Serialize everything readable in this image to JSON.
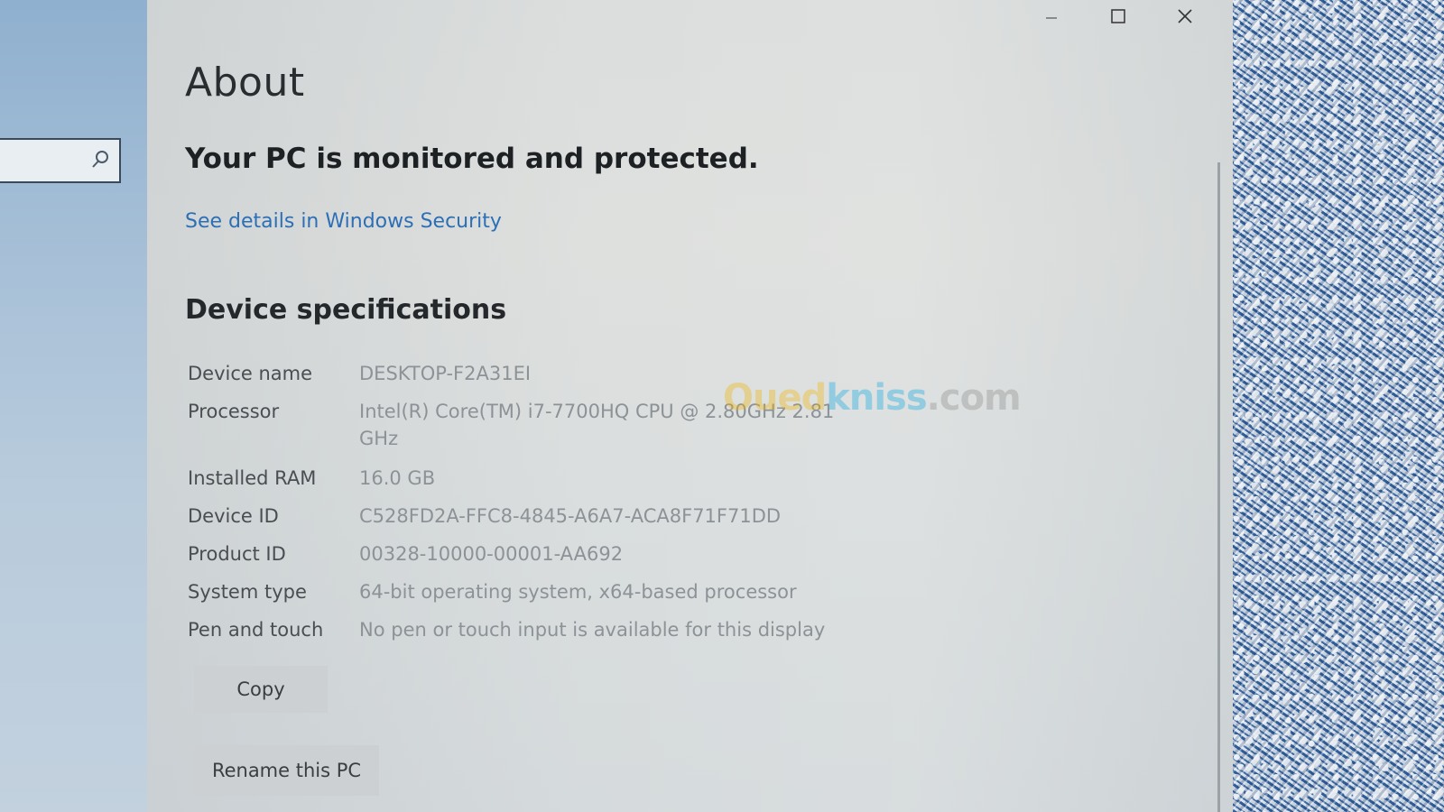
{
  "window": {
    "title": "About",
    "controls": {
      "minimize_icon": "minimize-icon",
      "maximize_icon": "maximize-icon",
      "close_icon": "close-icon"
    }
  },
  "sidebar": {
    "search_icon": "search-icon"
  },
  "status": {
    "heading": "Your PC is monitored and protected.",
    "link": "See details in Windows Security"
  },
  "device_specs": {
    "heading": "Device specifications",
    "rows": [
      {
        "label": "Device name",
        "value": "DESKTOP-F2A31EI"
      },
      {
        "label": "Processor",
        "value": "Intel(R) Core(TM) i7-7700HQ CPU @ 2.80GHz   2.81 GHz"
      },
      {
        "label": "Installed RAM",
        "value": "16.0 GB"
      },
      {
        "label": "Device ID",
        "value": "C528FD2A-FFC8-4845-A6A7-ACA8F71F71DD"
      },
      {
        "label": "Product ID",
        "value": "00328-10000-00001-AA692"
      },
      {
        "label": "System type",
        "value": "64-bit operating system, x64-based processor"
      },
      {
        "label": "Pen and touch",
        "value": "No pen or touch input is available for this display"
      }
    ],
    "copy_button": "Copy"
  },
  "rename_button": "Rename this PC",
  "watermark": {
    "part1": "Oued",
    "part2": "kniss",
    "part3": ".com"
  },
  "colors": {
    "link": "#2c6fb5",
    "window_bg": "#dcdedc",
    "sidebar_bg": "#a9c1d8"
  }
}
